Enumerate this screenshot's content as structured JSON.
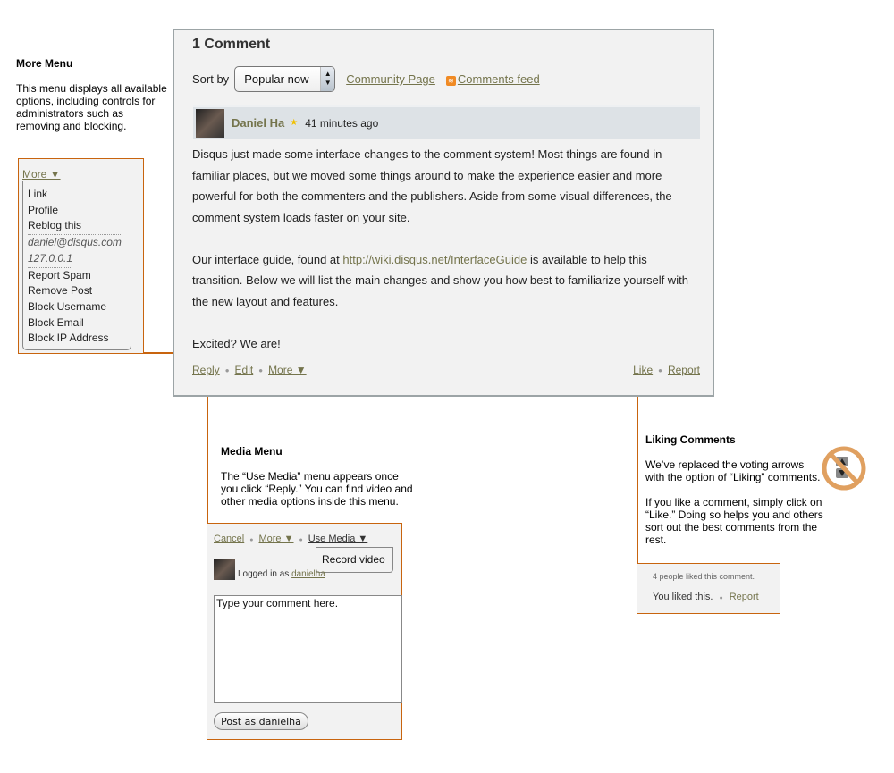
{
  "annotations": {
    "more_menu": {
      "title": "More Menu",
      "text": "This menu displays all available options, including controls for administrators such as removing and blocking."
    },
    "media_menu": {
      "title": "Media Menu",
      "text": "The “Use Media” menu appears once you click “Reply.” You can find video and other media options inside this menu."
    },
    "liking": {
      "title": "Liking Comments",
      "text1": "We’ve replaced the voting arrows with the option of “Liking” comments.",
      "text2": "If you like a comment, simply click on “Like.” Doing so helps you and others sort out the best comments from the rest."
    }
  },
  "thread": {
    "title": "1 Comment",
    "sort_label": "Sort by",
    "sort_value": "Popular now",
    "community_link": "Community Page",
    "feed_link": "Comments feed",
    "comment": {
      "author": "Daniel Ha",
      "time": "41 minutes ago",
      "paragraphs": [
        "Disqus just made some interface changes to the comment system! Most things are found in familiar places, but we moved some things around to make the experience easier and more powerful for both the commenters and the publishers. Aside from some visual differences, the comment system loads faster on your site.",
        "Excited? We are!"
      ],
      "p2_before": "Our interface guide, found at ",
      "p2_link": "http://wiki.disqus.net/InterfaceGuide",
      "p2_after": " is available to help this transition. Below we will list the main changes and show you how best to familiarize yourself with the new layout and features.",
      "actions": {
        "reply": "Reply",
        "edit": "Edit",
        "more": "More ▼",
        "like": "Like",
        "report": "Report"
      }
    }
  },
  "more_menu": {
    "toggle": "More ▼",
    "items": [
      "Link",
      "Profile",
      "Reblog this",
      "daniel@disqus.com",
      "127.0.0.1",
      "Report Spam",
      "Remove Post",
      "Block Username",
      "Block Email",
      "Block IP Address"
    ]
  },
  "reply_box": {
    "cancel": "Cancel",
    "more": "More ▼",
    "use_media": "Use Media ▼",
    "record_video": "Record video",
    "logged_in_as": "Logged in as",
    "username": "danielha",
    "placeholder": "Type your comment here.",
    "post_button": "Post as danielha"
  },
  "like_box": {
    "count_text": "4 people liked this comment.",
    "you_liked": "You liked this.",
    "report": "Report"
  },
  "colors": {
    "accent": "#c8640e",
    "link": "#74744c",
    "panel": "#f2f2f2",
    "header": "#dde2e6"
  }
}
